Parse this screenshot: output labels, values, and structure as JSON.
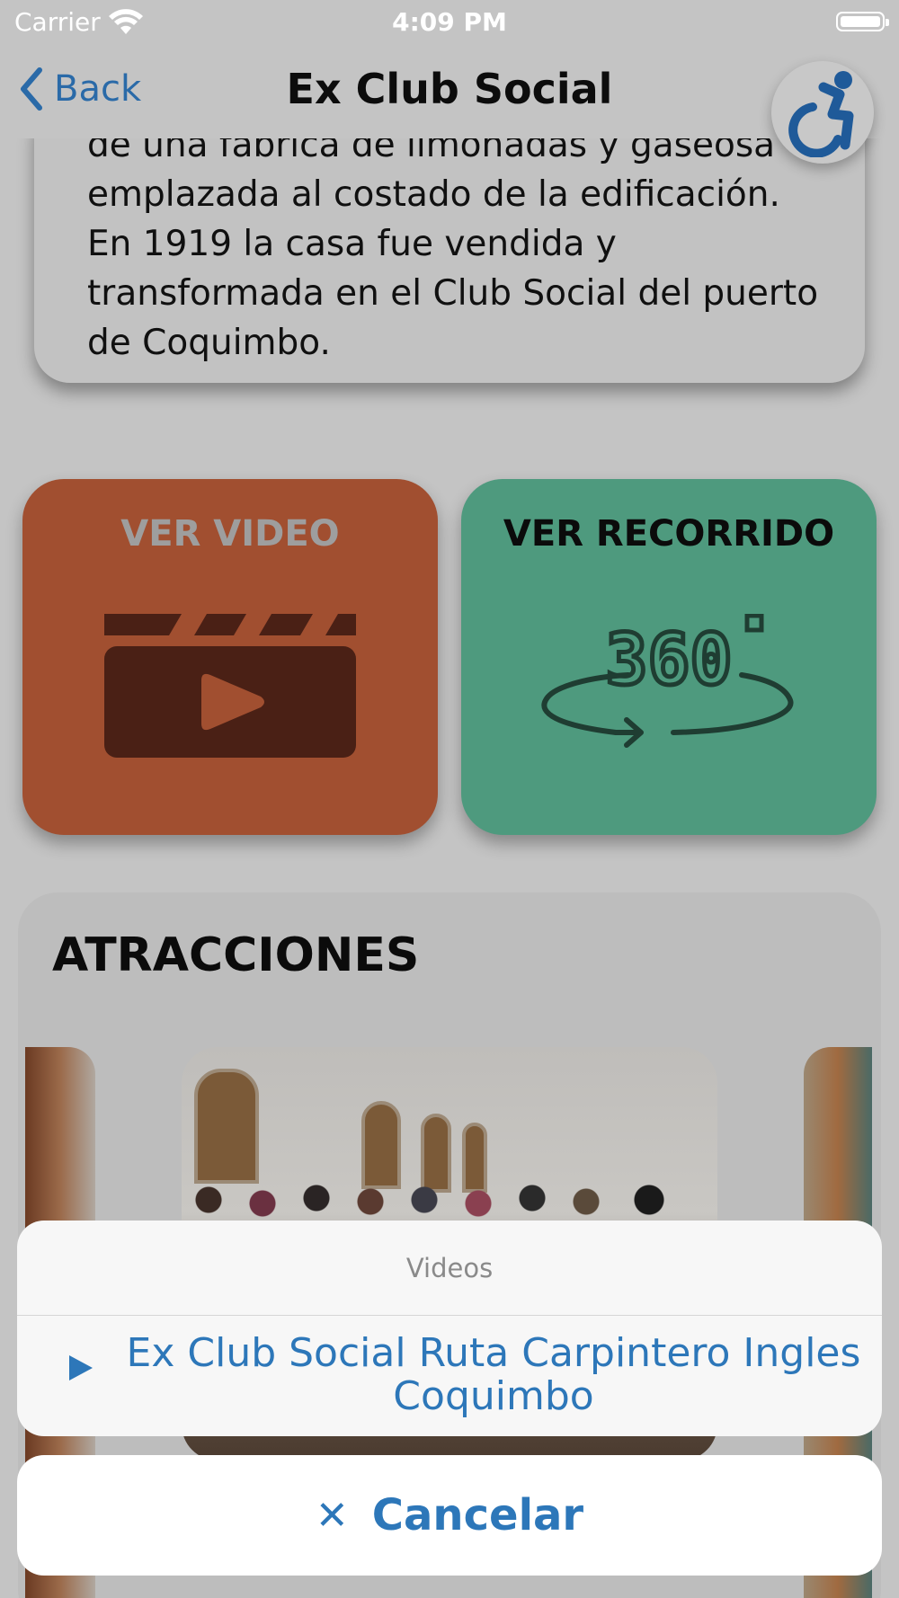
{
  "status_bar": {
    "carrier": "Carrier",
    "time": "4:09 PM"
  },
  "nav": {
    "back_label": "Back",
    "title": "Ex Club Social"
  },
  "description": {
    "line1": "de una fábrica de limonadas y gaseosa",
    "line2": "emplazada al costado de la edificación.",
    "line3": "En 1919 la casa fue vendida y",
    "line4": "transformada en el Club Social del puerto",
    "line5": "de Coquimbo."
  },
  "actions": {
    "video_label": "VER VIDEO",
    "tour_label": "VER RECORRIDO",
    "video_color": "#a14f30",
    "tour_color": "#4e9a7e"
  },
  "attractions": {
    "heading": "ATRACCIONES"
  },
  "action_sheet": {
    "title": "Videos",
    "option_line1": "Ex Club Social Ruta Carpintero Ingles",
    "option_line2": "Coquimbo",
    "cancel_label": "Cancelar"
  },
  "colors": {
    "accent_blue": "#2d77b9",
    "overlay_dim": "#c4c4c4"
  }
}
